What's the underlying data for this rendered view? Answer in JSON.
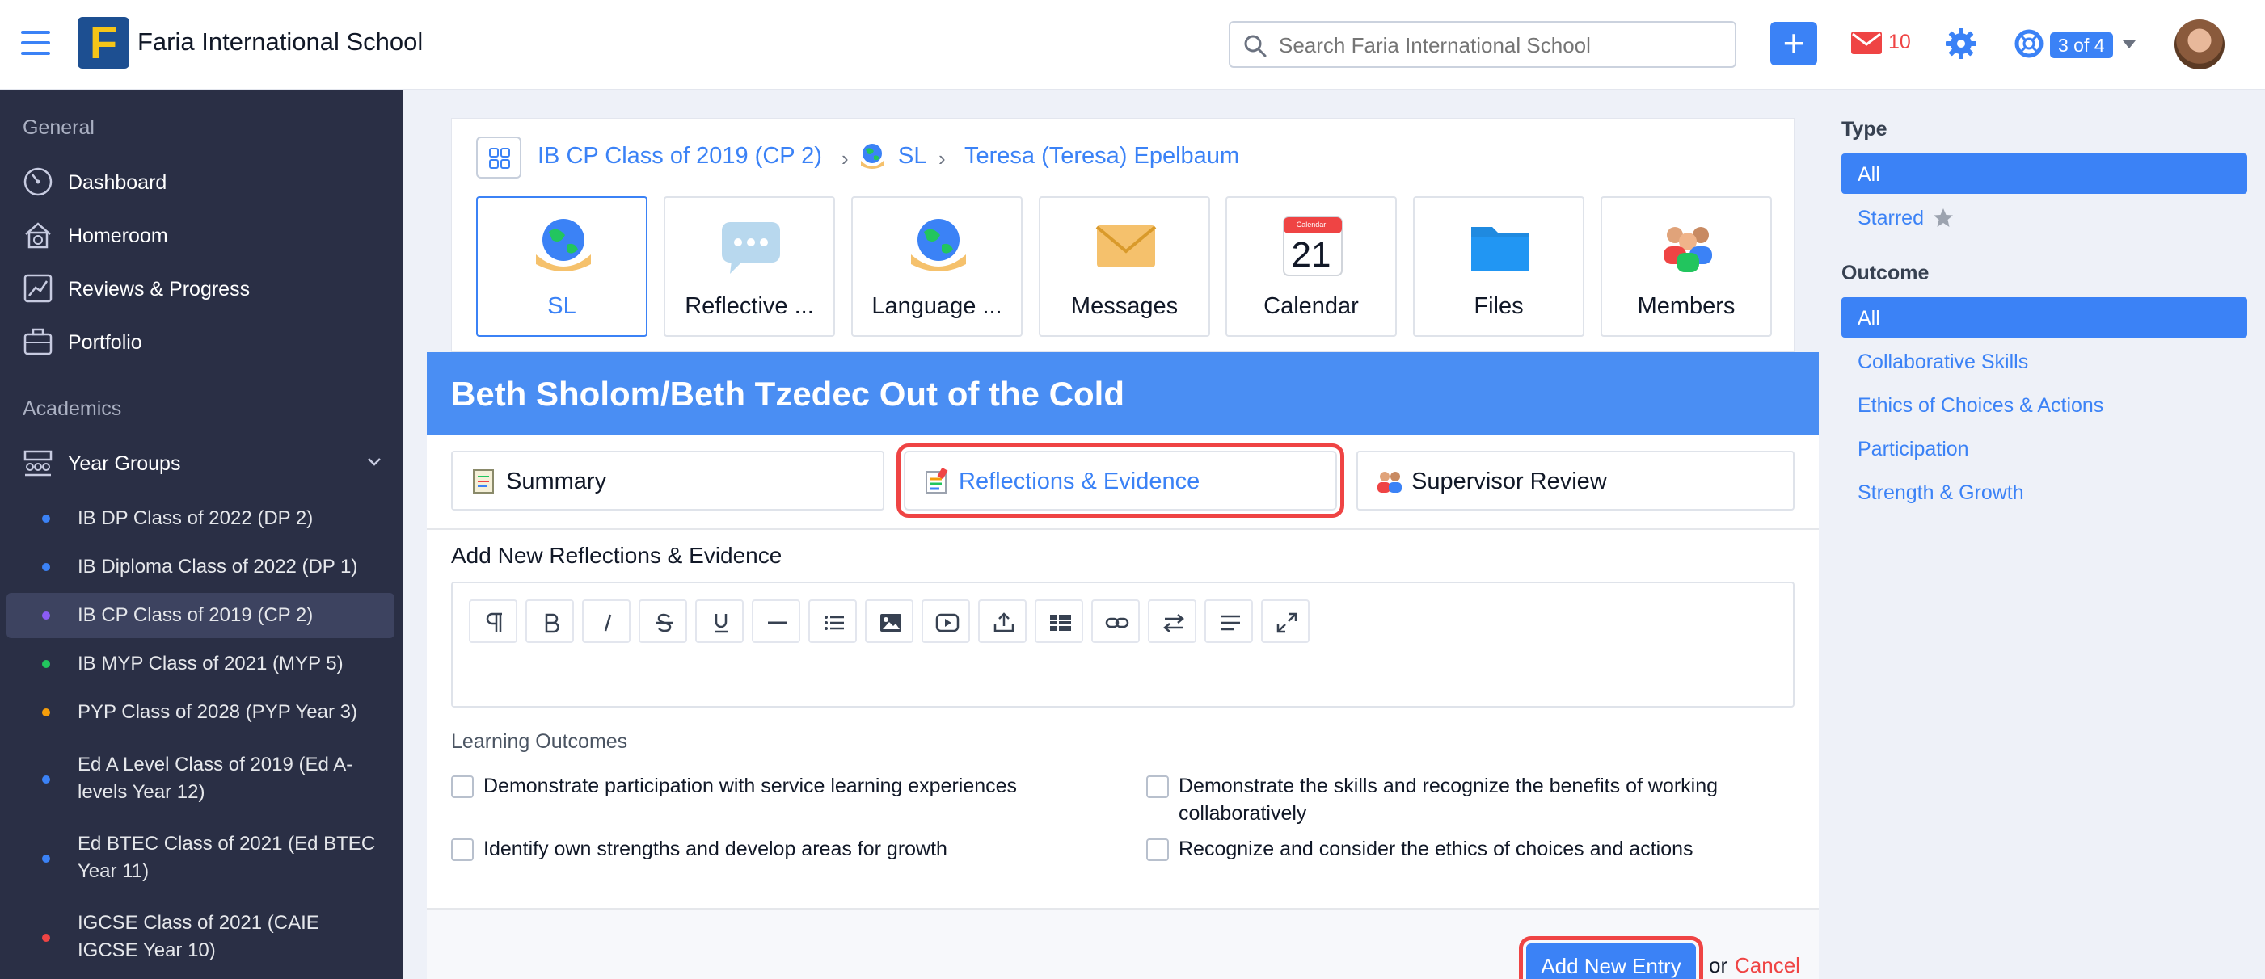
{
  "header": {
    "school_name": "Faria International School",
    "search_placeholder": "Search Faria International School",
    "mail_count": "10",
    "help_badge": "3 of 4"
  },
  "sidebar": {
    "general_heading": "General",
    "items": [
      {
        "label": "Dashboard",
        "icon": "dashboard-icon"
      },
      {
        "label": "Homeroom",
        "icon": "homeroom-icon"
      },
      {
        "label": "Reviews & Progress",
        "icon": "chart-icon"
      },
      {
        "label": "Portfolio",
        "icon": "briefcase-icon"
      }
    ],
    "academics_heading": "Academics",
    "year_groups_label": "Year Groups",
    "groups": [
      {
        "label": "IB DP Class of 2022 (DP 2)",
        "dot": "#3b82f6"
      },
      {
        "label": "IB Diploma Class of 2022 (DP 1)",
        "dot": "#3b82f6"
      },
      {
        "label": "IB CP Class of 2019 (CP 2)",
        "dot": "#8b5cf6"
      },
      {
        "label": "IB MYP Class of 2021 (MYP 5)",
        "dot": "#22c55e"
      },
      {
        "label": "PYP Class of 2028 (PYP Year 3)",
        "dot": "#f59e0b"
      },
      {
        "label": "Ed A Level Class of 2019 (Ed A-levels Year 12)",
        "dot": "#3b82f6"
      },
      {
        "label": "Ed BTEC Class of 2021 (Ed BTEC Year 11)",
        "dot": "#3b82f6"
      },
      {
        "label": "IGCSE Class of 2021 (CAIE IGCSE Year 10)",
        "dot": "#ef4444"
      }
    ]
  },
  "breadcrumb": {
    "class": "IB CP Class of 2019 (CP 2)",
    "section": "SL",
    "student": "Teresa (Teresa) Epelbaum"
  },
  "tiles": [
    {
      "label": "SL",
      "icon": "globe-hands-icon"
    },
    {
      "label": "Reflective ...",
      "icon": "speech-bubble-icon"
    },
    {
      "label": "Language ...",
      "icon": "globe-hands-icon"
    },
    {
      "label": "Messages",
      "icon": "envelope-icon"
    },
    {
      "label": "Calendar",
      "icon": "calendar-icon",
      "day": "21",
      "month": "Calendar"
    },
    {
      "label": "Files",
      "icon": "folder-icon"
    },
    {
      "label": "Members",
      "icon": "people-icon"
    }
  ],
  "activity_title": "Beth Sholom/Beth Tzedec Out of the Cold",
  "subtabs": [
    {
      "label": "Summary"
    },
    {
      "label": "Reflections & Evidence"
    },
    {
      "label": "Supervisor Review"
    }
  ],
  "editor": {
    "section_title": "Add New Reflections & Evidence"
  },
  "outcomes": {
    "label": "Learning Outcomes",
    "items": [
      "Demonstrate participation with service learning experiences",
      "Demonstrate the skills and recognize the benefits of working collaboratively",
      "Identify own strengths and develop areas for growth",
      "Recognize and consider the ethics of choices and actions"
    ]
  },
  "footer": {
    "add_label": "Add New Entry",
    "or_text": "or",
    "cancel_label": "Cancel"
  },
  "filters": {
    "type_heading": "Type",
    "type_items": [
      "All",
      "Starred"
    ],
    "outcome_heading": "Outcome",
    "outcome_items": [
      "All",
      "Collaborative Skills",
      "Ethics of Choices & Actions",
      "Participation",
      "Strength & Growth"
    ]
  },
  "colors": {
    "accent": "#3b82f6",
    "sidebar_bg": "#2a2f45",
    "title_bar": "#4a8ef3",
    "alert": "#ef4444"
  }
}
